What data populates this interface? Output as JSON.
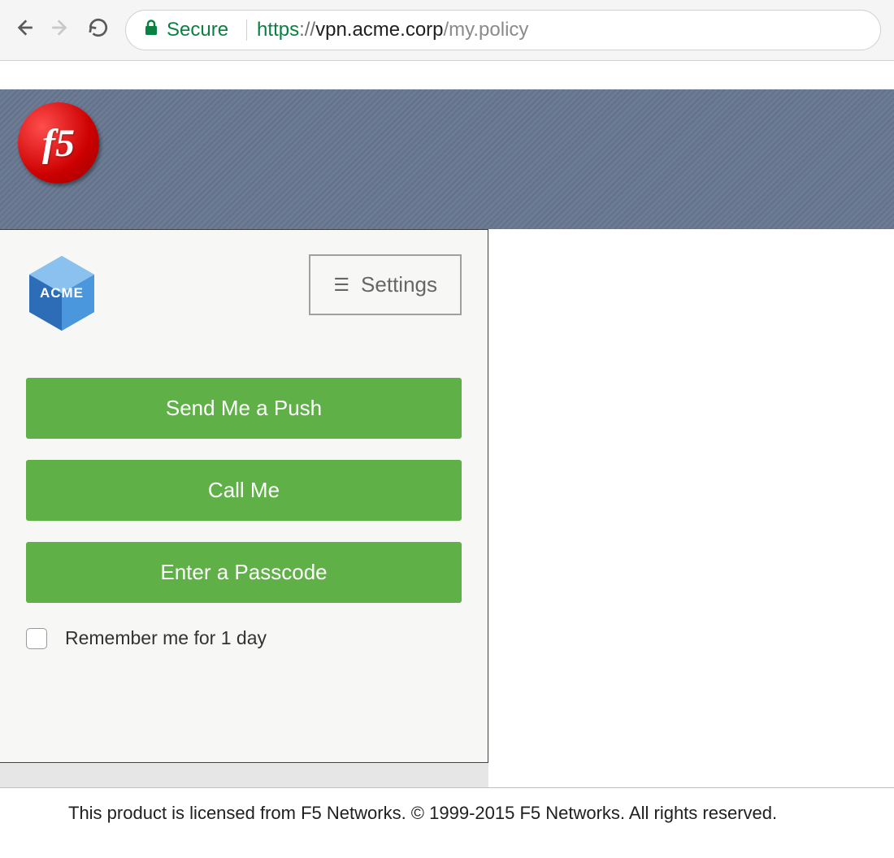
{
  "browser": {
    "secure_label": "Secure",
    "url_protocol": "https",
    "url_protocol_sep": "://",
    "url_host": "vpn.acme.corp",
    "url_path": "/my.policy"
  },
  "banner": {
    "f5_logo_text": "f5"
  },
  "duo": {
    "acme_label": "ACME",
    "settings_label": "Settings",
    "buttons": {
      "push": "Send Me a Push",
      "call": "Call Me",
      "passcode": "Enter a Passcode"
    },
    "remember_label": "Remember me for 1 day"
  },
  "footer": {
    "text": "This product is licensed from F5 Networks. © 1999-2015 F5 Networks. All rights reserved."
  },
  "colors": {
    "accent_green": "#5fb147",
    "banner_bg": "#6d7c94",
    "secure_green": "#0b8043"
  }
}
